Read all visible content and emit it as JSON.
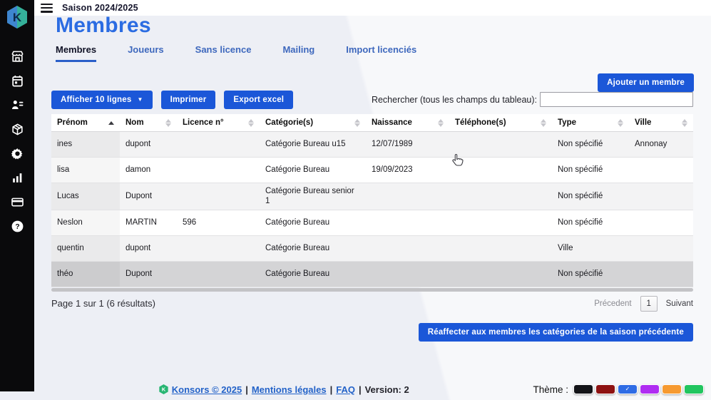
{
  "topbar": {
    "season": "Saison 2024/2025"
  },
  "page": {
    "title": "Membres"
  },
  "tabs": [
    {
      "label": "Membres",
      "active": true
    },
    {
      "label": "Joueurs",
      "active": false
    },
    {
      "label": "Sans licence",
      "active": false
    },
    {
      "label": "Mailing",
      "active": false
    },
    {
      "label": "Import licenciés",
      "active": false
    }
  ],
  "toolbar": {
    "show_lines_label": "Afficher 10 lignes",
    "print_label": "Imprimer",
    "export_label": "Export excel",
    "add_member_label": "Ajouter un membre",
    "search_label": "Rechercher (tous les champs du tableau):",
    "search_value": ""
  },
  "table": {
    "columns": [
      "Prénom",
      "Nom",
      "Licence n°",
      "Catégorie(s)",
      "Naissance",
      "Téléphone(s)",
      "Type",
      "Ville"
    ],
    "sorted_column": "Prénom",
    "rows": [
      {
        "prenom": "ines",
        "nom": "dupont",
        "licence": "",
        "categories": "Catégorie Bureau u15",
        "naissance": "12/07/1989",
        "telephone": "",
        "type": "Non spécifié",
        "ville": "Annonay",
        "highlight": false
      },
      {
        "prenom": "lisa",
        "nom": "damon",
        "licence": "",
        "categories": "Catégorie Bureau",
        "naissance": "19/09/2023",
        "telephone": "",
        "type": "Non spécifié",
        "ville": "",
        "highlight": false
      },
      {
        "prenom": "Lucas",
        "nom": "Dupont",
        "licence": "",
        "categories": "Catégorie Bureau senior 1",
        "naissance": "",
        "telephone": "",
        "type": "Non spécifié",
        "ville": "",
        "highlight": false
      },
      {
        "prenom": "Neslon",
        "nom": "MARTIN",
        "licence": "596",
        "categories": "Catégorie Bureau",
        "naissance": "",
        "telephone": "",
        "type": "Non spécifié",
        "ville": "",
        "highlight": false
      },
      {
        "prenom": "quentin",
        "nom": "dupont",
        "licence": "",
        "categories": "Catégorie Bureau",
        "naissance": "",
        "telephone": "",
        "type": "Ville",
        "ville": "",
        "highlight": false
      },
      {
        "prenom": "théo",
        "nom": "Dupont",
        "licence": "",
        "categories": "Catégorie Bureau",
        "naissance": "",
        "telephone": "",
        "type": "Non spécifié",
        "ville": "",
        "highlight": true
      }
    ]
  },
  "pagination": {
    "summary": "Page 1 sur 1 (6 résultats)",
    "previous": "Précedent",
    "current": "1",
    "next": "Suivant"
  },
  "actions": {
    "reassign_label": "Réaffecter aux membres les catégories de la saison précédente"
  },
  "footer": {
    "brand": "Konsors © 2025",
    "legal": "Mentions légales",
    "faq": "FAQ",
    "version": "Version: 2",
    "separator": "|",
    "theme_label": "Thème :",
    "themes": [
      {
        "name": "black",
        "color": "#131418",
        "selected": false
      },
      {
        "name": "dark-red",
        "color": "#8e1212",
        "selected": false
      },
      {
        "name": "blue",
        "color": "#2f6ce5",
        "selected": true
      },
      {
        "name": "purple",
        "color": "#b02df2",
        "selected": false
      },
      {
        "name": "orange",
        "color": "#f69a31",
        "selected": false
      },
      {
        "name": "green",
        "color": "#21c55f",
        "selected": false
      }
    ]
  },
  "sidebar": {
    "icons": [
      "storefront",
      "calendar",
      "members",
      "package",
      "settings",
      "stats",
      "card",
      "help"
    ]
  },
  "colors": {
    "accent": "#1b57d8",
    "heading": "#2b6ce2",
    "sidebar_bg": "#0a0a0c"
  }
}
